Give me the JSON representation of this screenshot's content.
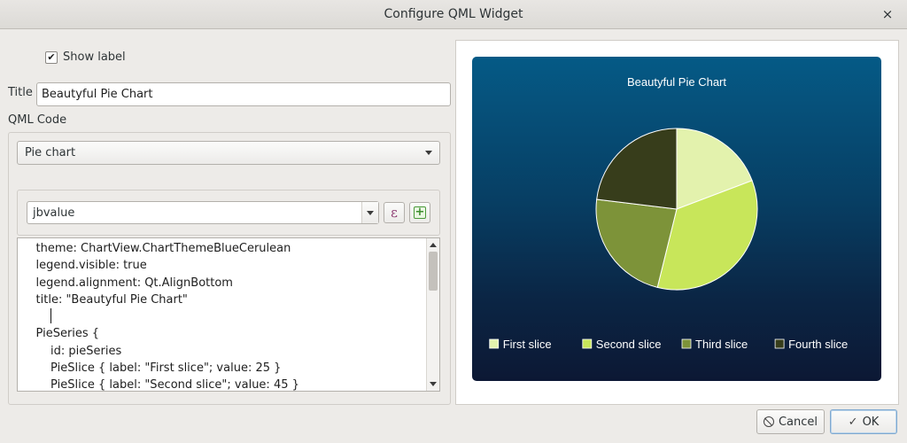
{
  "window": {
    "title": "Configure QML Widget",
    "close_glyph": "×"
  },
  "form": {
    "show_label": {
      "label": "Show label",
      "checked": true,
      "check_glyph": "✔"
    },
    "title_label": "Title",
    "title_value": "Beautyful Pie Chart",
    "qml_code_label": "QML Code",
    "template_select": "Pie chart",
    "data_source": "jbvalue",
    "expression_button_glyph": "ε",
    "add_button_glyph": "+",
    "code_lines": [
      "    theme: ChartView.ChartThemeBlueCerulean",
      "    legend.visible: true",
      "    legend.alignment: Qt.AlignBottom",
      "    title: \"Beautyful Pie Chart\"",
      "",
      "    PieSeries {",
      "        id: pieSeries",
      "        PieSlice { label: \"First slice\"; value: 25 }",
      "        PieSlice { label: \"Second slice\"; value: 45 }"
    ]
  },
  "preview": {
    "theme_colors": {
      "bg_top": "#055a86",
      "bg_bottom": "#0c1834",
      "text": "#ffffff"
    }
  },
  "chart_data": {
    "type": "pie",
    "title": "Beautyful Pie Chart",
    "legend_position": "bottom",
    "slices": [
      {
        "label": "First slice",
        "value": 25,
        "color": "#e3f2ad"
      },
      {
        "label": "Second slice",
        "value": 45,
        "color": "#c8e65a"
      },
      {
        "label": "Third slice",
        "value": 30,
        "color": "#7d9339"
      },
      {
        "label": "Fourth slice",
        "value": 30,
        "color": "#373d1b"
      }
    ]
  },
  "buttons": {
    "cancel_label": "Cancel",
    "cancel_icon": "⃠",
    "ok_label": "OK",
    "ok_icon": "✓"
  },
  "icons": {
    "close": "close-icon",
    "check": "checkmark-icon",
    "cancel": "cancel-circle-icon",
    "ok": "checkmark-icon",
    "expression": "epsilon-icon",
    "add": "plus-icon"
  }
}
